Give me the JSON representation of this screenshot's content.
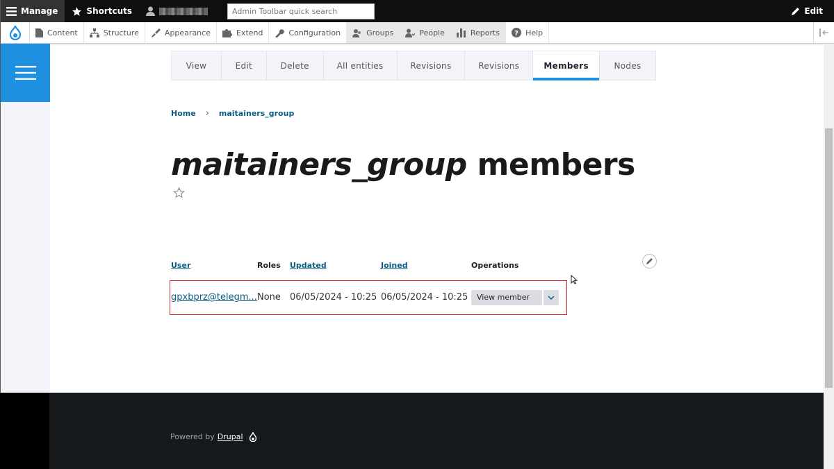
{
  "toolbar": {
    "manage_label": "Manage",
    "shortcuts_label": "Shortcuts",
    "search_placeholder": "Admin Toolbar quick search",
    "edit_label": "Edit"
  },
  "tray": {
    "items": [
      {
        "label": "Content",
        "icon": "file-icon"
      },
      {
        "label": "Structure",
        "icon": "sitemap-icon"
      },
      {
        "label": "Appearance",
        "icon": "paintbrush-icon"
      },
      {
        "label": "Extend",
        "icon": "puzzle-icon"
      },
      {
        "label": "Configuration",
        "icon": "wrench-icon"
      },
      {
        "label": "Groups",
        "icon": "groups-icon"
      },
      {
        "label": "People",
        "icon": "people-icon"
      },
      {
        "label": "Reports",
        "icon": "bar-chart-icon"
      },
      {
        "label": "Help",
        "icon": "help-icon"
      }
    ]
  },
  "tabs": [
    {
      "label": "View"
    },
    {
      "label": "Edit"
    },
    {
      "label": "Delete"
    },
    {
      "label": "All entities"
    },
    {
      "label": "Revisions"
    },
    {
      "label": "Revisions"
    },
    {
      "label": "Members",
      "active": true
    },
    {
      "label": "Nodes"
    }
  ],
  "breadcrumb": {
    "home": "Home",
    "current": "maitainers_group"
  },
  "page": {
    "title_italic": "maitainers_group",
    "title_rest": " members"
  },
  "table": {
    "headers": {
      "user": "User",
      "roles": "Roles",
      "updated": "Updated",
      "joined": "Joined",
      "operations": "Operations"
    },
    "rows": [
      {
        "user": "gpxbprz@telegm...",
        "roles": "None",
        "updated": "06/05/2024 - 10:25",
        "joined": "06/05/2024 - 10:25",
        "operation": "View member"
      }
    ]
  },
  "footer": {
    "powered_by": "Powered by",
    "drupal_link": "Drupal"
  },
  "colors": {
    "accent_blue": "#1f8fe0",
    "link": "#0a5e85",
    "highlight_border": "#d9262c"
  }
}
